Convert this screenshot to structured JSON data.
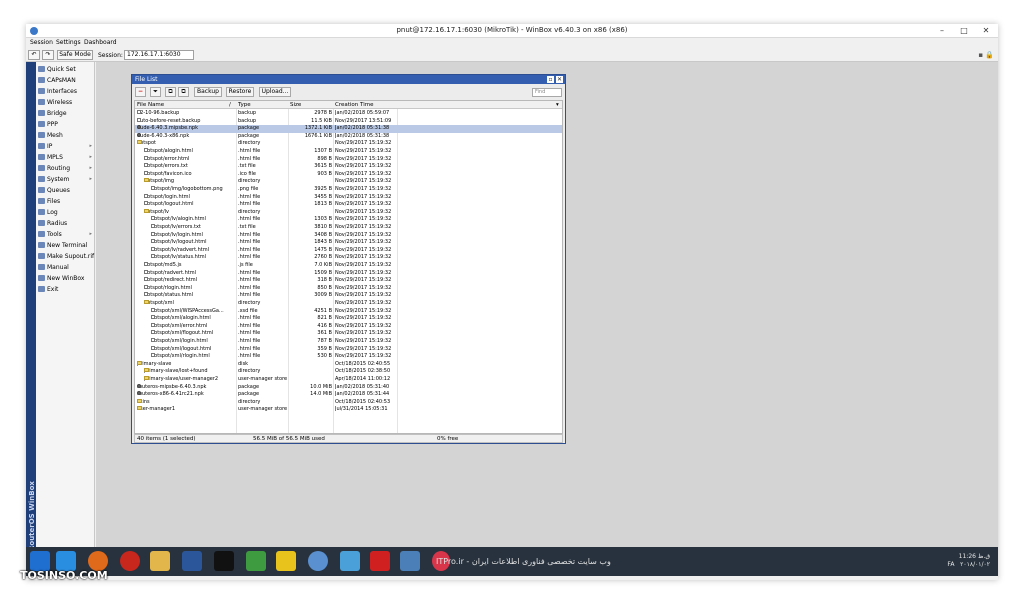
{
  "window": {
    "title": "pnut@172.16.17.1:6030 (MikroTik) - WinBox v6.40.3 on x86 (x86)"
  },
  "menu": [
    "Session",
    "Settings",
    "Dashboard"
  ],
  "toolbar": {
    "undo": "↶",
    "redo": "↷",
    "safe_mode": "Safe Mode",
    "session_label": "Session:",
    "session_value": "172.16.17.1:6030"
  },
  "sidebar": {
    "brand": "RouterOS WinBox",
    "items": [
      {
        "label": "Quick Set",
        "arrow": ""
      },
      {
        "label": "CAPsMAN",
        "arrow": ""
      },
      {
        "label": "Interfaces",
        "arrow": ""
      },
      {
        "label": "Wireless",
        "arrow": ""
      },
      {
        "label": "Bridge",
        "arrow": ""
      },
      {
        "label": "PPP",
        "arrow": ""
      },
      {
        "label": "Mesh",
        "arrow": ""
      },
      {
        "label": "IP",
        "arrow": "▸"
      },
      {
        "label": "MPLS",
        "arrow": "▸"
      },
      {
        "label": "Routing",
        "arrow": "▸"
      },
      {
        "label": "System",
        "arrow": "▸"
      },
      {
        "label": "Queues",
        "arrow": ""
      },
      {
        "label": "Files",
        "arrow": ""
      },
      {
        "label": "Log",
        "arrow": ""
      },
      {
        "label": "Radius",
        "arrow": ""
      },
      {
        "label": "Tools",
        "arrow": "▸"
      },
      {
        "label": "New Terminal",
        "arrow": ""
      },
      {
        "label": "Make Supout.rif",
        "arrow": ""
      },
      {
        "label": "Manual",
        "arrow": ""
      },
      {
        "label": "New WinBox",
        "arrow": ""
      },
      {
        "label": "Exit",
        "arrow": ""
      }
    ]
  },
  "filelist": {
    "title": "File List",
    "buttons": {
      "remove": "−",
      "filter": "⏷",
      "copy": "⧉",
      "paste": "⧉",
      "backup": "Backup",
      "restore": "Restore",
      "upload": "Upload..."
    },
    "find_placeholder": "Find",
    "columns": {
      "name": "File Name",
      "type": "Type",
      "size": "Size",
      "created": "Creation Time"
    },
    "rows": [
      {
        "name": "12-10-96.backup",
        "type": "backup",
        "size": "2978 B",
        "created": "Jan/02/2018 05:59:07",
        "icon": "file",
        "indent": 0
      },
      {
        "name": "auto-before-reset.backup",
        "type": "backup",
        "size": "11.5 KiB",
        "created": "Nov/29/2017 13:51:09",
        "icon": "file",
        "indent": 0
      },
      {
        "name": "dude-6.40.3.mipsbe.npk",
        "type": "package",
        "size": "1372.1 KiB",
        "created": "Jan/02/2018 05:31:38",
        "icon": "pkg",
        "indent": 0,
        "selected": true
      },
      {
        "name": "dude-6.40.3-x86.npk",
        "type": "package",
        "size": "1676.1 KiB",
        "created": "Jan/02/2018 05:31:38",
        "icon": "pkg",
        "indent": 0
      },
      {
        "name": "hotspot",
        "type": "directory",
        "size": "",
        "created": "Nov/29/2017 15:19:32",
        "icon": "dir",
        "indent": 0
      },
      {
        "name": "hotspot/alogin.html",
        "type": ".html file",
        "size": "1307 B",
        "created": "Nov/29/2017 15:19:32",
        "icon": "file",
        "indent": 1
      },
      {
        "name": "hotspot/error.html",
        "type": ".html file",
        "size": "898 B",
        "created": "Nov/29/2017 15:19:32",
        "icon": "file",
        "indent": 1
      },
      {
        "name": "hotspot/errors.txt",
        "type": ".txt file",
        "size": "3615 B",
        "created": "Nov/29/2017 15:19:32",
        "icon": "file",
        "indent": 1
      },
      {
        "name": "hotspot/favicon.ico",
        "type": ".ico file",
        "size": "903 B",
        "created": "Nov/29/2017 15:19:32",
        "icon": "file",
        "indent": 1
      },
      {
        "name": "hotspot/img",
        "type": "directory",
        "size": "",
        "created": "Nov/29/2017 15:19:32",
        "icon": "dir",
        "indent": 1
      },
      {
        "name": "hotspot/img/logobottom.png",
        "type": ".png file",
        "size": "3925 B",
        "created": "Nov/29/2017 15:19:32",
        "icon": "file",
        "indent": 2
      },
      {
        "name": "hotspot/login.html",
        "type": ".html file",
        "size": "3455 B",
        "created": "Nov/29/2017 15:19:32",
        "icon": "file",
        "indent": 1
      },
      {
        "name": "hotspot/logout.html",
        "type": ".html file",
        "size": "1813 B",
        "created": "Nov/29/2017 15:19:32",
        "icon": "file",
        "indent": 1
      },
      {
        "name": "hotspot/lv",
        "type": "directory",
        "size": "",
        "created": "Nov/29/2017 15:19:32",
        "icon": "dir",
        "indent": 1
      },
      {
        "name": "hotspot/lv/alogin.html",
        "type": ".html file",
        "size": "1303 B",
        "created": "Nov/29/2017 15:19:32",
        "icon": "file",
        "indent": 2
      },
      {
        "name": "hotspot/lv/errors.txt",
        "type": ".txt file",
        "size": "3810 B",
        "created": "Nov/29/2017 15:19:32",
        "icon": "file",
        "indent": 2
      },
      {
        "name": "hotspot/lv/login.html",
        "type": ".html file",
        "size": "3408 B",
        "created": "Nov/29/2017 15:19:32",
        "icon": "file",
        "indent": 2
      },
      {
        "name": "hotspot/lv/logout.html",
        "type": ".html file",
        "size": "1843 B",
        "created": "Nov/29/2017 15:19:32",
        "icon": "file",
        "indent": 2
      },
      {
        "name": "hotspot/lv/radvert.html",
        "type": ".html file",
        "size": "1475 B",
        "created": "Nov/29/2017 15:19:32",
        "icon": "file",
        "indent": 2
      },
      {
        "name": "hotspot/lv/status.html",
        "type": ".html file",
        "size": "2760 B",
        "created": "Nov/29/2017 15:19:32",
        "icon": "file",
        "indent": 2
      },
      {
        "name": "hotspot/md5.js",
        "type": ".js file",
        "size": "7.0 KiB",
        "created": "Nov/29/2017 15:19:32",
        "icon": "file",
        "indent": 1
      },
      {
        "name": "hotspot/radvert.html",
        "type": ".html file",
        "size": "1509 B",
        "created": "Nov/29/2017 15:19:32",
        "icon": "file",
        "indent": 1
      },
      {
        "name": "hotspot/redirect.html",
        "type": ".html file",
        "size": "318 B",
        "created": "Nov/29/2017 15:19:32",
        "icon": "file",
        "indent": 1
      },
      {
        "name": "hotspot/rlogin.html",
        "type": ".html file",
        "size": "850 B",
        "created": "Nov/29/2017 15:19:32",
        "icon": "file",
        "indent": 1
      },
      {
        "name": "hotspot/status.html",
        "type": ".html file",
        "size": "3009 B",
        "created": "Nov/29/2017 15:19:32",
        "icon": "file",
        "indent": 1
      },
      {
        "name": "hotspot/xml",
        "type": "directory",
        "size": "",
        "created": "Nov/29/2017 15:19:32",
        "icon": "dir",
        "indent": 1
      },
      {
        "name": "hotspot/xml/WISPAccessGa...",
        "type": ".xsd file",
        "size": "4251 B",
        "created": "Nov/29/2017 15:19:32",
        "icon": "file",
        "indent": 2
      },
      {
        "name": "hotspot/xml/alogin.html",
        "type": ".html file",
        "size": "821 B",
        "created": "Nov/29/2017 15:19:32",
        "icon": "file",
        "indent": 2
      },
      {
        "name": "hotspot/xml/error.html",
        "type": ".html file",
        "size": "416 B",
        "created": "Nov/29/2017 15:19:32",
        "icon": "file",
        "indent": 2
      },
      {
        "name": "hotspot/xml/flogout.html",
        "type": ".html file",
        "size": "361 B",
        "created": "Nov/29/2017 15:19:32",
        "icon": "file",
        "indent": 2
      },
      {
        "name": "hotspot/xml/login.html",
        "type": ".html file",
        "size": "787 B",
        "created": "Nov/29/2017 15:19:32",
        "icon": "file",
        "indent": 2
      },
      {
        "name": "hotspot/xml/logout.html",
        "type": ".html file",
        "size": "359 B",
        "created": "Nov/29/2017 15:19:32",
        "icon": "file",
        "indent": 2
      },
      {
        "name": "hotspot/xml/rlogin.html",
        "type": ".html file",
        "size": "530 B",
        "created": "Nov/29/2017 15:19:32",
        "icon": "file",
        "indent": 2
      },
      {
        "name": "primary-slave",
        "type": "disk",
        "size": "",
        "created": "Oct/18/2015 02:40:55",
        "icon": "dir",
        "indent": 0
      },
      {
        "name": "primary-slave/lost+found",
        "type": "directory",
        "size": "",
        "created": "Oct/18/2015 02:38:50",
        "icon": "dir",
        "indent": 1
      },
      {
        "name": "primary-slave/user-manager2",
        "type": "user-manager store",
        "size": "",
        "created": "Apr/18/2014 11:00:12",
        "icon": "dir",
        "indent": 1
      },
      {
        "name": "routeros-mipsbe-6.40.3.npk",
        "type": "package",
        "size": "10.0 MiB",
        "created": "Jan/02/2018 05:31:40",
        "icon": "pkg",
        "indent": 0
      },
      {
        "name": "routeros-x86-6.41rc21.npk",
        "type": "package",
        "size": "14.0 MiB",
        "created": "Jan/02/2018 05:31:44",
        "icon": "pkg",
        "indent": 0
      },
      {
        "name": "skins",
        "type": "directory",
        "size": "",
        "created": "Oct/18/2015 02:40:53",
        "icon": "dir",
        "indent": 0
      },
      {
        "name": "user-manager1",
        "type": "user-manager store",
        "size": "",
        "created": "Jul/31/2014 15:05:31",
        "icon": "dir",
        "indent": 0
      }
    ],
    "status": {
      "count": "40 items (1 selected)",
      "usage": "56.5 MiB of 56.5 MiB used",
      "free": "0% free"
    }
  },
  "taskbar": {
    "promo": "ITPro.ir - وب سایت تخصصی فناوری اطلاعات ایران",
    "tray_lang": "FA",
    "tray_time": "11:26 ق.ظ",
    "tray_date": "۲۰۱۸/۰۱/۰۲"
  },
  "watermark": "TOSINSO.COM"
}
